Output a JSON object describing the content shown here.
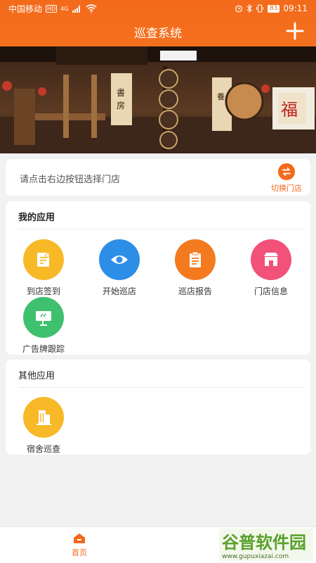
{
  "status_bar": {
    "carrier": "中国移动",
    "hd": "HD",
    "network": "4G",
    "battery": "83",
    "time": "09:11"
  },
  "header": {
    "title": "巡查系统"
  },
  "store": {
    "hint": "请点击右边按钮选择门店",
    "switch_label": "切换门店"
  },
  "my_apps": {
    "title": "我的应用",
    "items": [
      {
        "label": "到店签到",
        "icon": "checkin-icon",
        "color": "#f7b928"
      },
      {
        "label": "开始巡店",
        "icon": "eye-icon",
        "color": "#2d8ee8"
      },
      {
        "label": "巡店报告",
        "icon": "report-icon",
        "color": "#f47a1f"
      },
      {
        "label": "门店信息",
        "icon": "store-icon",
        "color": "#f2527a"
      },
      {
        "label": "广告牌跟踪",
        "icon": "billboard-icon",
        "color": "#3ec06e"
      }
    ]
  },
  "other_apps": {
    "title": "其他应用",
    "items": [
      {
        "label": "宿舍巡查",
        "icon": "building-icon",
        "color": "#f7b928"
      }
    ]
  },
  "bottom_nav": {
    "home_label": "首页"
  },
  "watermark": {
    "brand": "谷普软件园",
    "url": "www.gupuxiazai.com"
  },
  "colors": {
    "accent": "#f36a1b"
  }
}
